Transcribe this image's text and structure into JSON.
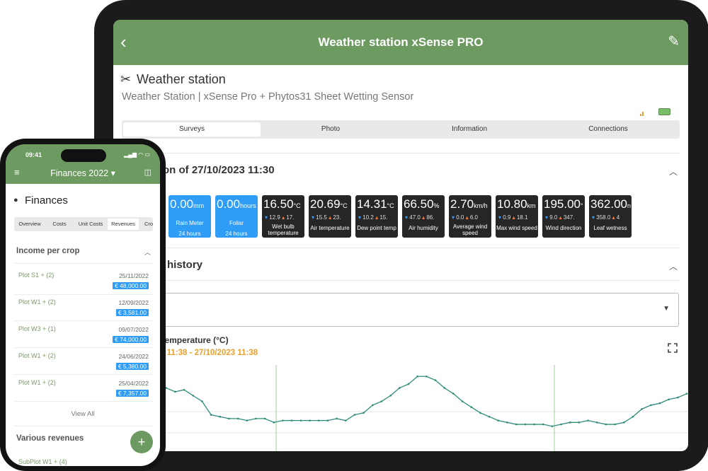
{
  "tablet": {
    "header_title": "Weather station xSense PRO",
    "back_icon": "chevron-left-icon",
    "edit_icon": "pencil-icon",
    "station_title": "Weather station",
    "station_subtitle": "Weather Station | xSense Pro + Phytos31 Sheet Wetting Sensor",
    "tabs": [
      {
        "label": "Surveys",
        "active": true
      },
      {
        "label": "Photo",
        "active": false
      },
      {
        "label": "Information",
        "active": false
      },
      {
        "label": "Connections",
        "active": false
      }
    ],
    "last_reading_title": "on of 27/10/2023 11:30",
    "tiles": [
      {
        "value": "0.00",
        "unit": "mm",
        "label": "Rain Meter",
        "sub": "24 hours",
        "color": "blue"
      },
      {
        "value": "0.00",
        "unit": "hours",
        "label": "Foliar",
        "sub": "24 hours",
        "color": "blue"
      },
      {
        "value": "16.50",
        "unit": "°C",
        "min": "12.9",
        "max": "17.",
        "label": "Wet bulb temperature",
        "color": "dark"
      },
      {
        "value": "20.69",
        "unit": "°C",
        "min": "15.5",
        "max": "23.",
        "label": "Air temperature",
        "color": "dark"
      },
      {
        "value": "14.31",
        "unit": "°C",
        "min": "10.2",
        "max": "15.",
        "label": "Dew point temp",
        "color": "dark"
      },
      {
        "value": "66.50",
        "unit": "%",
        "min": "47.0",
        "max": "86.",
        "label": "Air humidity",
        "color": "dark"
      },
      {
        "value": "2.70",
        "unit": "km/h",
        "min": "0.0",
        "max": "6.0",
        "label": "Average wind speed",
        "color": "dark"
      },
      {
        "value": "10.80",
        "unit": "km",
        "min": "0.9",
        "max": "18.1",
        "label": "Max wind speed",
        "color": "dark"
      },
      {
        "value": "195.00",
        "unit": "°",
        "min": "9.0",
        "max": "347.",
        "label": "Wind direction",
        "color": "dark"
      },
      {
        "value": "362.00",
        "unit": "n",
        "min": "358.0",
        "max": "4",
        "label": "Leaf wetness",
        "color": "dark"
      }
    ],
    "history_title": "history",
    "chart_title": "Temperature (°C)",
    "chart_range": "3 11:38 - 27/10/2023 11:38",
    "colors": {
      "accent": "#6c9a60",
      "tile_blue": "#2f9cf5",
      "tile_dark": "#262626",
      "line": "#2e8b7a",
      "range": "#e8a030"
    }
  },
  "phone": {
    "time": "09:41",
    "status_icons": "signal-wifi-battery-icon",
    "header_title": "Finances 2022",
    "menu_icon": "hamburger-icon",
    "map_icon": "map-icon",
    "page_title": "Finances",
    "tabs": [
      {
        "label": "Overview",
        "active": false
      },
      {
        "label": "Costs",
        "active": false
      },
      {
        "label": "Unit Costs",
        "active": false
      },
      {
        "label": "Revenues",
        "active": true
      },
      {
        "label": "Cro",
        "active": false
      }
    ],
    "income_title": "Income per crop",
    "rows": [
      {
        "plot": "Plot S1 + (2)",
        "date": "25/11/2022",
        "amount": "€ 48,000.00"
      },
      {
        "plot": "Plot W1 + (2)",
        "date": "12/09/2022",
        "amount": "€ 3,581.00"
      },
      {
        "plot": "Plot W3 + (1)",
        "date": "09/07/2022",
        "amount": "€ 74,000.00"
      },
      {
        "plot": "Plot W1 + (2)",
        "date": "24/06/2022",
        "amount": "€ 5,380.00"
      },
      {
        "plot": "Plot W1 + (2)",
        "date": "25/04/2022",
        "amount": "€ 7,357.00"
      }
    ],
    "view_all": "View All",
    "various_title": "Various revenues",
    "partial_row": "SubPlot W1 + (4)",
    "fab_label": "+"
  },
  "chart_data": {
    "type": "line",
    "title": "Temperature (°C)",
    "x": [
      0,
      1,
      2,
      3,
      4,
      5,
      6,
      7,
      8,
      9,
      10,
      11,
      12,
      13,
      14,
      15,
      16,
      17,
      18,
      19,
      20,
      21,
      22,
      23,
      24,
      25,
      26,
      27,
      28,
      29,
      30,
      31,
      32,
      33,
      34,
      35,
      36,
      37,
      38,
      39,
      40,
      41,
      42,
      43,
      44,
      45,
      46,
      47,
      48,
      49,
      50,
      51,
      52,
      53,
      54,
      55,
      56,
      57,
      58,
      59
    ],
    "series": [
      {
        "values": [
          19.6,
          19.8,
          19.6,
          19.7,
          19.4,
          19.1,
          18.4,
          18.3,
          18.2,
          18.2,
          18.1,
          18.2,
          18.2,
          18.0,
          18.1,
          18.1,
          18.1,
          18.1,
          18.1,
          18.1,
          18.2,
          18.1,
          18.4,
          18.5,
          18.9,
          19.1,
          19.4,
          19.8,
          20.0,
          20.4,
          20.4,
          20.2,
          19.8,
          19.5,
          19.1,
          18.8,
          18.5,
          18.3,
          18.1,
          18.0,
          17.9,
          17.9,
          17.9,
          17.9,
          17.8,
          17.9,
          18.0,
          18.0,
          18.1,
          18.0,
          17.9,
          17.9,
          18.0,
          18.3,
          18.7,
          18.9,
          19.0,
          19.2,
          19.3,
          19.5
        ]
      }
    ]
  }
}
